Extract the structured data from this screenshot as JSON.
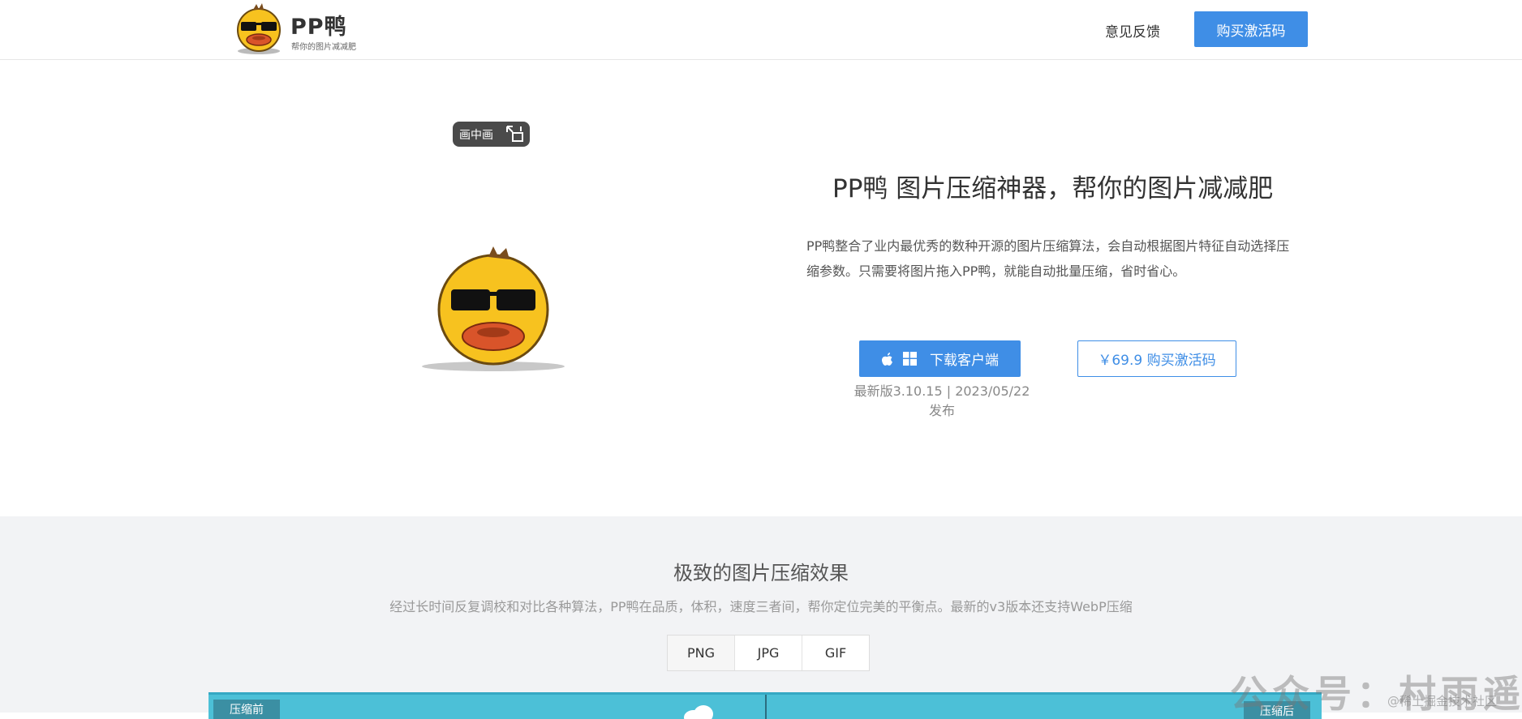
{
  "header": {
    "logo_title": "PP鸭",
    "logo_subtitle": "帮你的图片减减肥",
    "feedback_label": "意见反馈",
    "buy_label": "购买激活码"
  },
  "hero": {
    "pip_label": "画中画",
    "title": "PP鸭  图片压缩神器，帮你的图片减减肥",
    "description": "PP鸭整合了业内最优秀的数种开源的图片压缩算法，会自动根据图片特征自动选择压缩参数。只需要将图片拖入PP鸭，就能自动批量压缩，省时省心。",
    "download_label": "下载客户端",
    "buy_label": "￥69.9 购买激活码",
    "version_text": "最新版3.10.15 | 2023/05/22 发布"
  },
  "section2": {
    "title": "极致的图片压缩效果",
    "description": "经过长时间反复调校和对比各种算法，PP鸭在品质，体积，速度三者间，帮你定位完美的平衡点。最新的v3版本还支持WebP压缩",
    "tabs": [
      "PNG",
      "JPG",
      "GIF"
    ],
    "before_label": "压缩前",
    "after_label": "压缩后"
  },
  "watermark": {
    "main": "公众号：村雨遥",
    "sub": "@稀土掘金技术社区"
  },
  "colors": {
    "primary": "#3f8ee6",
    "preview_bg": "#4cc0d7",
    "section_bg": "#f2f3f5"
  },
  "icons": [
    "apple-icon",
    "windows-icon",
    "pip-exit-icon",
    "cloud-icon"
  ]
}
